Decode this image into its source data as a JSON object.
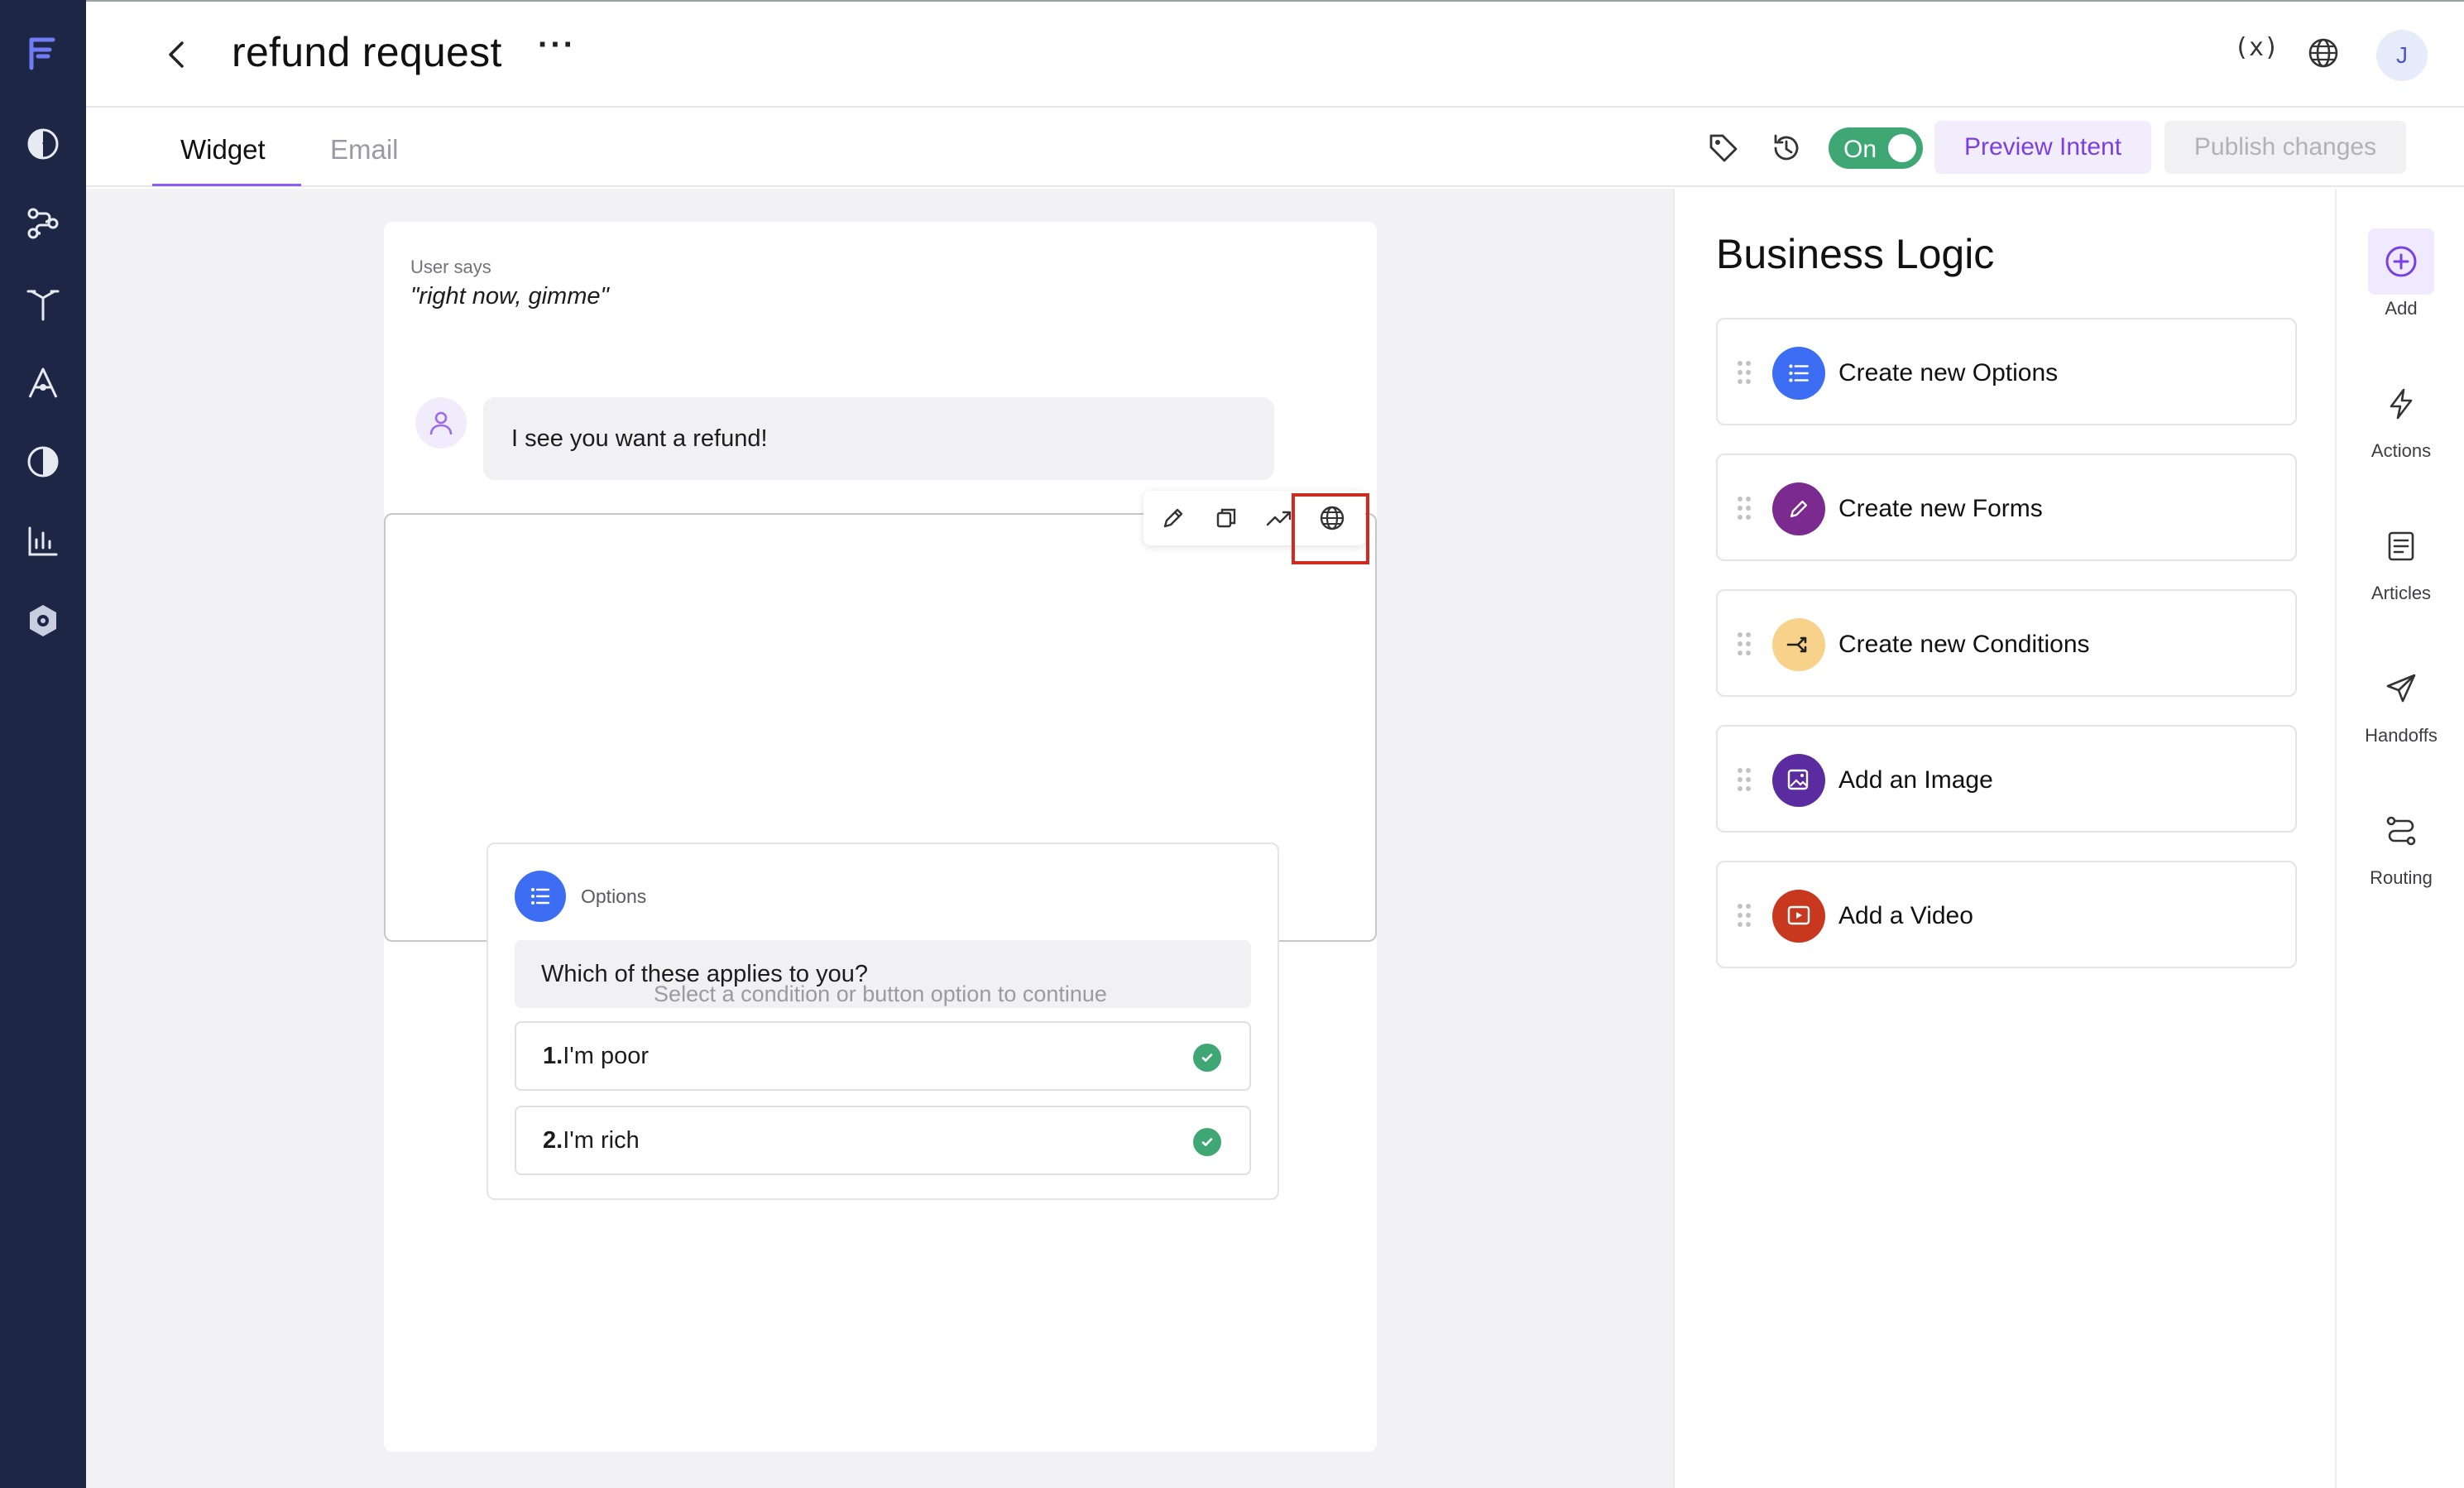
{
  "header": {
    "title": "refund request",
    "more": "···",
    "variables": "(x)",
    "avatar_initial": "J"
  },
  "tabs": [
    {
      "label": "Widget",
      "active": true
    },
    {
      "label": "Email",
      "active": false
    }
  ],
  "toolbar": {
    "toggle_label": "On",
    "toggle_on": true,
    "preview_label": "Preview Intent",
    "publish_label": "Publish changes"
  },
  "conversation": {
    "user_says_label": "User says",
    "user_says_text": "\"right now, gimme\"",
    "bot_message": "I see you want a refund!",
    "options_block": {
      "type_label": "Options",
      "question": "Which of these applies to you?",
      "choices": [
        {
          "number": "1.",
          "label": "I'm poor",
          "checked": true
        },
        {
          "number": "2.",
          "label": "I'm rich",
          "checked": true
        }
      ]
    },
    "continue_hint": "Select a condition or button option to continue"
  },
  "business_logic": {
    "title": "Business Logic",
    "items": [
      {
        "label": "Create new Options",
        "icon": "list-icon",
        "color": "#3d6df2"
      },
      {
        "label": "Create new Forms",
        "icon": "pencil-icon",
        "color": "#7b2a8f"
      },
      {
        "label": "Create new Conditions",
        "icon": "branch-icon",
        "color": "#f6d28a"
      },
      {
        "label": "Add an Image",
        "icon": "image-icon",
        "color": "#5b2ca0"
      },
      {
        "label": "Add a Video",
        "icon": "video-icon",
        "color": "#c8381f"
      }
    ]
  },
  "rail": {
    "items": [
      {
        "label": "Add",
        "icon": "plus-circle-icon",
        "active": true
      },
      {
        "label": "Actions",
        "icon": "bolt-icon",
        "active": false
      },
      {
        "label": "Articles",
        "icon": "article-icon",
        "active": false
      },
      {
        "label": "Handoffs",
        "icon": "send-icon",
        "active": false
      },
      {
        "label": "Routing",
        "icon": "routing-icon",
        "active": false
      }
    ]
  },
  "colors": {
    "nav_bg": "#1d2645",
    "accent": "#8b5cf6",
    "toggle_on": "#3ea774",
    "highlight": "#cc2d20"
  }
}
